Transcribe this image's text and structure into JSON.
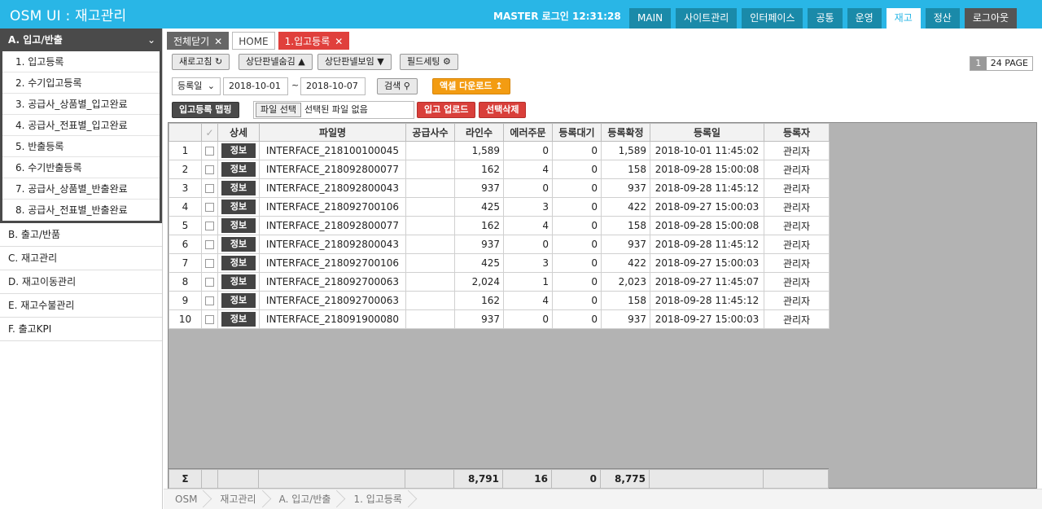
{
  "header": {
    "title": "OSM UI : 재고관리",
    "login_text": "MASTER 로그인 12:31:28",
    "nav": [
      "MAIN",
      "사이트관리",
      "인터페이스",
      "공통",
      "운영",
      "재고",
      "정산",
      "로그아웃"
    ],
    "active_nav": "재고"
  },
  "sidebar": {
    "group_a": "A. 입고/반출",
    "chevron_icon": "chevron-down-icon",
    "items": [
      "1. 입고등록",
      "2. 수기입고등록",
      "3. 공급사_상품별_입고완료",
      "4. 공급사_전표별_입고완료",
      "5. 반출등록",
      "6. 수기반출등록",
      "7. 공급사_상품별_반출완료",
      "8. 공급사_전표별_반출완료"
    ],
    "groups": [
      "B. 출고/반품",
      "C. 재고관리",
      "D. 재고이동관리",
      "E. 재고수불관리",
      "F. 출고KPI"
    ]
  },
  "tabs": {
    "close_all": "전체닫기",
    "home": "HOME",
    "current": "1.입고등록"
  },
  "toolbar": {
    "refresh": "새로고침",
    "hide_panel": "상단판넬숨김",
    "show_panel": "상단판넬보임",
    "field_settings": "필드세팅",
    "page_num": "1",
    "page_text": "24 PAGE"
  },
  "filter": {
    "date_type": "등록일",
    "date_from": "2018-10-01",
    "date_sep": "~",
    "date_to": "2018-10-07",
    "search": "검색",
    "excel_download": "액셀 다운로드"
  },
  "upload": {
    "mapping": "입고등록 맵핑",
    "file_select": "파일 선택",
    "no_file": "선택된 파일 없음",
    "upload_btn": "입고 업로드",
    "delete_btn": "선택삭제"
  },
  "grid": {
    "headers": [
      "",
      "",
      "상세",
      "파일명",
      "공급사수",
      "라인수",
      "에러주문",
      "등록대기",
      "등록확정",
      "등록일",
      "등록자"
    ],
    "rows": [
      {
        "no": "1",
        "detail": "정보",
        "file": "INTERFACE_218100100045",
        "supplier": "",
        "lines": "1,589",
        "error": "0",
        "wait": "0",
        "confirmed": "1,589",
        "date": "2018-10-01 11:45:02",
        "user": "관리자"
      },
      {
        "no": "2",
        "detail": "정보",
        "file": "INTERFACE_218092800077",
        "supplier": "",
        "lines": "162",
        "error": "4",
        "wait": "0",
        "confirmed": "158",
        "date": "2018-09-28 15:00:08",
        "user": "관리자"
      },
      {
        "no": "3",
        "detail": "정보",
        "file": "INTERFACE_218092800043",
        "supplier": "",
        "lines": "937",
        "error": "0",
        "wait": "0",
        "confirmed": "937",
        "date": "2018-09-28 11:45:12",
        "user": "관리자"
      },
      {
        "no": "4",
        "detail": "정보",
        "file": "INTERFACE_218092700106",
        "supplier": "",
        "lines": "425",
        "error": "3",
        "wait": "0",
        "confirmed": "422",
        "date": "2018-09-27 15:00:03",
        "user": "관리자"
      },
      {
        "no": "5",
        "detail": "정보",
        "file": "INTERFACE_218092800077",
        "supplier": "",
        "lines": "162",
        "error": "4",
        "wait": "0",
        "confirmed": "158",
        "date": "2018-09-28 15:00:08",
        "user": "관리자"
      },
      {
        "no": "6",
        "detail": "정보",
        "file": "INTERFACE_218092800043",
        "supplier": "",
        "lines": "937",
        "error": "0",
        "wait": "0",
        "confirmed": "937",
        "date": "2018-09-28 11:45:12",
        "user": "관리자"
      },
      {
        "no": "7",
        "detail": "정보",
        "file": "INTERFACE_218092700106",
        "supplier": "",
        "lines": "425",
        "error": "3",
        "wait": "0",
        "confirmed": "422",
        "date": "2018-09-27 15:00:03",
        "user": "관리자"
      },
      {
        "no": "8",
        "detail": "정보",
        "file": "INTERFACE_218092700063",
        "supplier": "",
        "lines": "2,024",
        "error": "1",
        "wait": "0",
        "confirmed": "2,023",
        "date": "2018-09-27 11:45:07",
        "user": "관리자"
      },
      {
        "no": "9",
        "detail": "정보",
        "file": "INTERFACE_218092700063",
        "supplier": "",
        "lines": "162",
        "error": "4",
        "wait": "0",
        "confirmed": "158",
        "date": "2018-09-28 11:45:12",
        "user": "관리자"
      },
      {
        "no": "10",
        "detail": "정보",
        "file": "INTERFACE_218091900080",
        "supplier": "",
        "lines": "937",
        "error": "0",
        "wait": "0",
        "confirmed": "937",
        "date": "2018-09-27 15:00:03",
        "user": "관리자"
      }
    ],
    "sum": {
      "sigma": "Σ",
      "lines": "8,791",
      "error": "16",
      "wait": "0",
      "confirmed": "8,775"
    }
  },
  "breadcrumb": [
    "OSM",
    "재고관리",
    "A. 입고/반출",
    "1. 입고등록"
  ]
}
